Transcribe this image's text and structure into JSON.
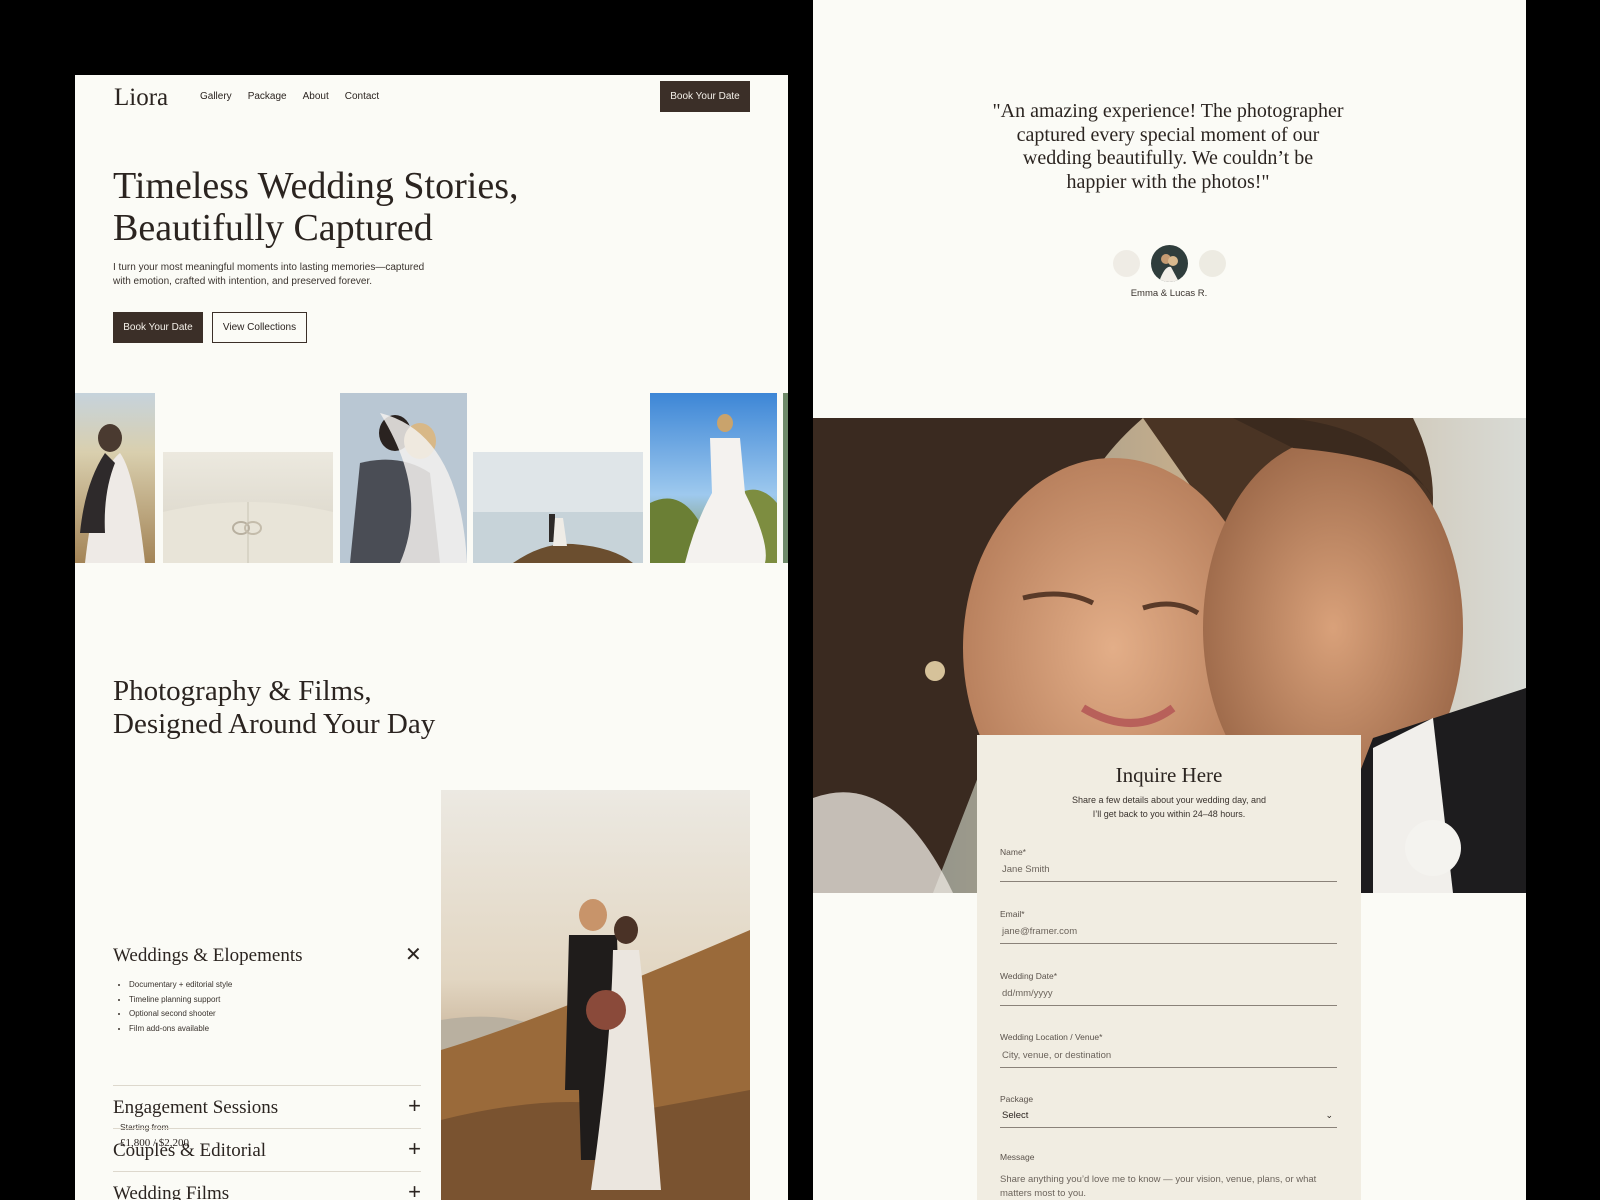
{
  "nav": {
    "logo": "Liora",
    "links": [
      "Gallery",
      "Package",
      "About",
      "Contact"
    ],
    "cta": "Book Your Date"
  },
  "hero": {
    "title_line1": "Timeless Wedding Stories,",
    "title_line2": "Beautifully Captured",
    "desc_line1": "I turn your most meaningful moments into lasting memories—captured",
    "desc_line2": "with emotion, crafted with intention, and preserved forever.",
    "primary_button": "Book Your Date",
    "secondary_button": "View Collections"
  },
  "services": {
    "title_line1": "Photography & Films,",
    "title_line2": "Designed Around Your Day",
    "open_item": {
      "title": "Weddings & Elopements",
      "bullets": [
        "Documentary + editorial style",
        "Timeline planning support",
        "Optional second shooter",
        "Film add-ons available"
      ],
      "starting_label": "Starting from",
      "price": "£1,800 / $2,200"
    },
    "collapsed_items": [
      "Engagement Sessions",
      "Couples & Editorial",
      "Wedding Films"
    ]
  },
  "testimonial": {
    "quote_line1": "\"An amazing experience! The photographer",
    "quote_line2": "captured every special moment of our",
    "quote_line3": "wedding beautifully. We couldn’t be",
    "quote_line4": "happier with the photos!\"",
    "author": "Emma & Lucas R."
  },
  "inquiry": {
    "title": "Inquire Here",
    "desc_line1": "Share a few details about your wedding day, and",
    "desc_line2": "I’ll get back to you within 24–48 hours.",
    "fields": {
      "name": {
        "label": "Name*",
        "value": "Jane Smith"
      },
      "email": {
        "label": "Email*",
        "value": "jane@framer.com"
      },
      "date": {
        "label": "Wedding Date*",
        "value": "dd/mm/yyyy"
      },
      "location": {
        "label": "Wedding Location / Venue*",
        "value": "City, venue, or destination"
      },
      "package": {
        "label": "Package",
        "value": "Select"
      },
      "message": {
        "label": "Message",
        "value": "Share anything you’d love me to know — your vision, venue, plans, or what matters most to you."
      }
    }
  },
  "colors": {
    "background": "#fbfbf6",
    "dark_button": "#3b2f28",
    "form_bg": "#f1ede2",
    "frame": "#000000"
  },
  "icons": {
    "accordion_close": "close-icon",
    "accordion_expand": "plus-icon",
    "select_chevron": "chevron-down-icon"
  }
}
